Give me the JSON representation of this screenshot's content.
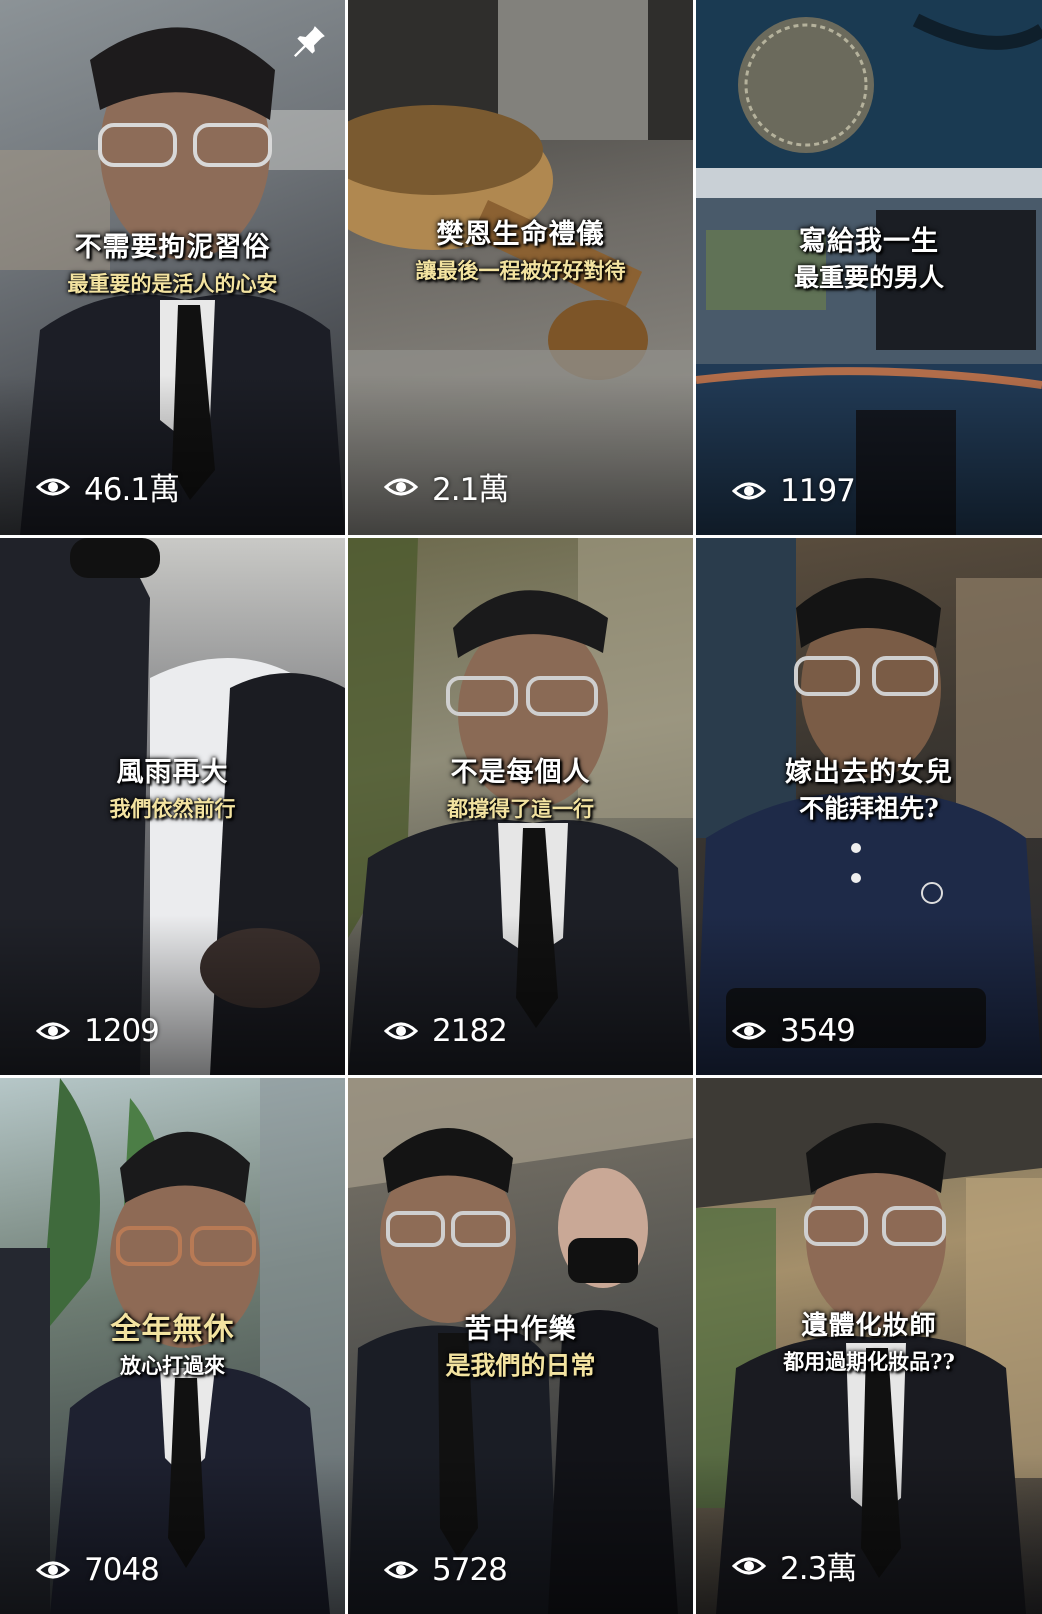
{
  "tiles": [
    {
      "line1": "不需要拘泥習俗",
      "line2": "最重要的是活人的心安",
      "views": "46.1萬",
      "pinned": true,
      "bg": "#4a4f58"
    },
    {
      "line1": "樊恩生命禮儀",
      "line2": "讓最後一程被好好對待",
      "views": "2.1萬",
      "pinned": false,
      "bg": "#5c5b57"
    },
    {
      "line1": "寫給我一生",
      "line2": "最重要的男人",
      "views": "1197",
      "pinned": false,
      "bg": "#1f3a4d"
    },
    {
      "line1": "風雨再大",
      "line2": "我們依然前行",
      "views": "1209",
      "pinned": false,
      "bg": "#3a3b40"
    },
    {
      "line1": "不是每個人",
      "line2": "都撐得了這一行",
      "views": "2182",
      "pinned": false,
      "bg": "#4b4c3e"
    },
    {
      "line1": "嫁出去的女兒",
      "line2": "不能拜祖先?",
      "views": "3549",
      "pinned": false,
      "bg": "#3e3a35"
    },
    {
      "line1": "全年無休",
      "line2": "放心打過來",
      "views": "7048",
      "pinned": false,
      "bg": "#5a6a6e"
    },
    {
      "line1": "苦中作樂",
      "line2": "是我們的日常",
      "views": "5728",
      "pinned": false,
      "bg": "#5b584f"
    },
    {
      "line1": "遺體化妝師",
      "line2": "都用過期化妝品??",
      "views": "2.3萬",
      "pinned": false,
      "bg": "#4d4f4a"
    }
  ]
}
